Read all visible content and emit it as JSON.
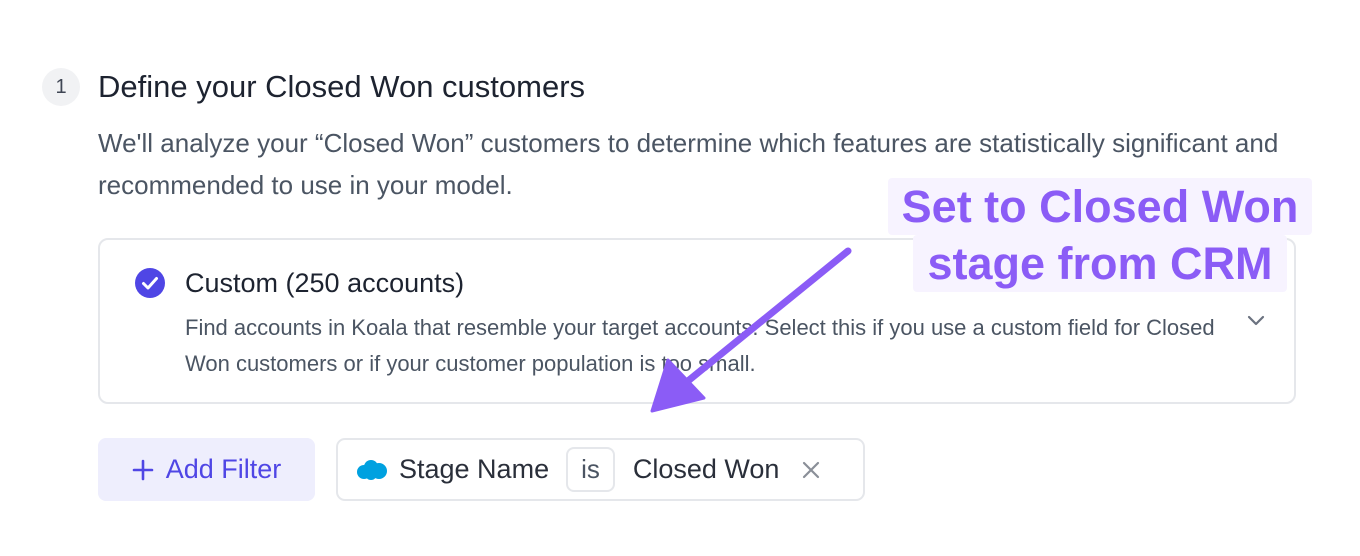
{
  "step": {
    "number": "1",
    "title": "Define your Closed Won customers",
    "description": "We'll analyze your “Closed Won” customers to determine which features are statistically significant and recommended to use in your model."
  },
  "option": {
    "title": "Custom (250 accounts)",
    "description": "Find accounts in Koala that resemble your target accounts. Select this if you use a custom field for Closed Won customers or if your customer population is too small.",
    "selected": true,
    "check_icon": "check-circle-icon",
    "expand_icon": "chevron-down-icon"
  },
  "filters": {
    "add_label": "Add Filter",
    "add_icon": "plus-icon",
    "chip": {
      "source_icon": "salesforce-icon",
      "field": "Stage Name",
      "operator": "is",
      "value": "Closed Won",
      "remove_icon": "close-icon"
    }
  },
  "annotation": {
    "line1": "Set to Closed Won",
    "line2": "stage from CRM",
    "color": "#8b5cf6"
  },
  "colors": {
    "accent": "#4f46e5",
    "annotation": "#8b5cf6"
  }
}
